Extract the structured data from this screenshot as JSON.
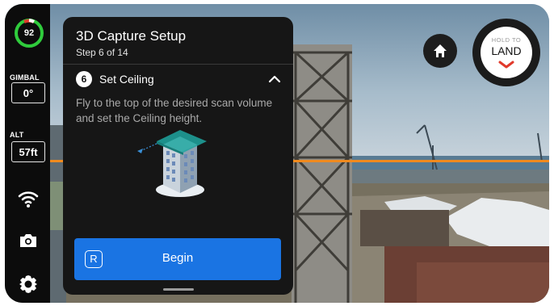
{
  "rail": {
    "battery": "92",
    "gimbal_label": "GIMBAL",
    "gimbal_value": "0°",
    "alt_label": "ALT",
    "alt_value": "57ft",
    "icons": [
      "wifi-icon",
      "camera-icon",
      "gear-icon"
    ]
  },
  "panel": {
    "title": "3D Capture Setup",
    "subtitle": "Step 6 of 14",
    "step_number": "6",
    "step_title": "Set Ceiling",
    "description": "Fly to the top of the desired scan volume and set the Ceiling height.",
    "begin_key": "R",
    "begin_label": "Begin"
  },
  "controls": {
    "hold_to": "HOLD TO",
    "land": "LAND",
    "icons": [
      "home-icon",
      "chevron-down-icon"
    ]
  },
  "colors": {
    "accent_blue": "#1a74e3",
    "battery_green": "#2fcb3c",
    "land_red": "#e13a2c",
    "ceiling_line": "#f08a1e"
  }
}
